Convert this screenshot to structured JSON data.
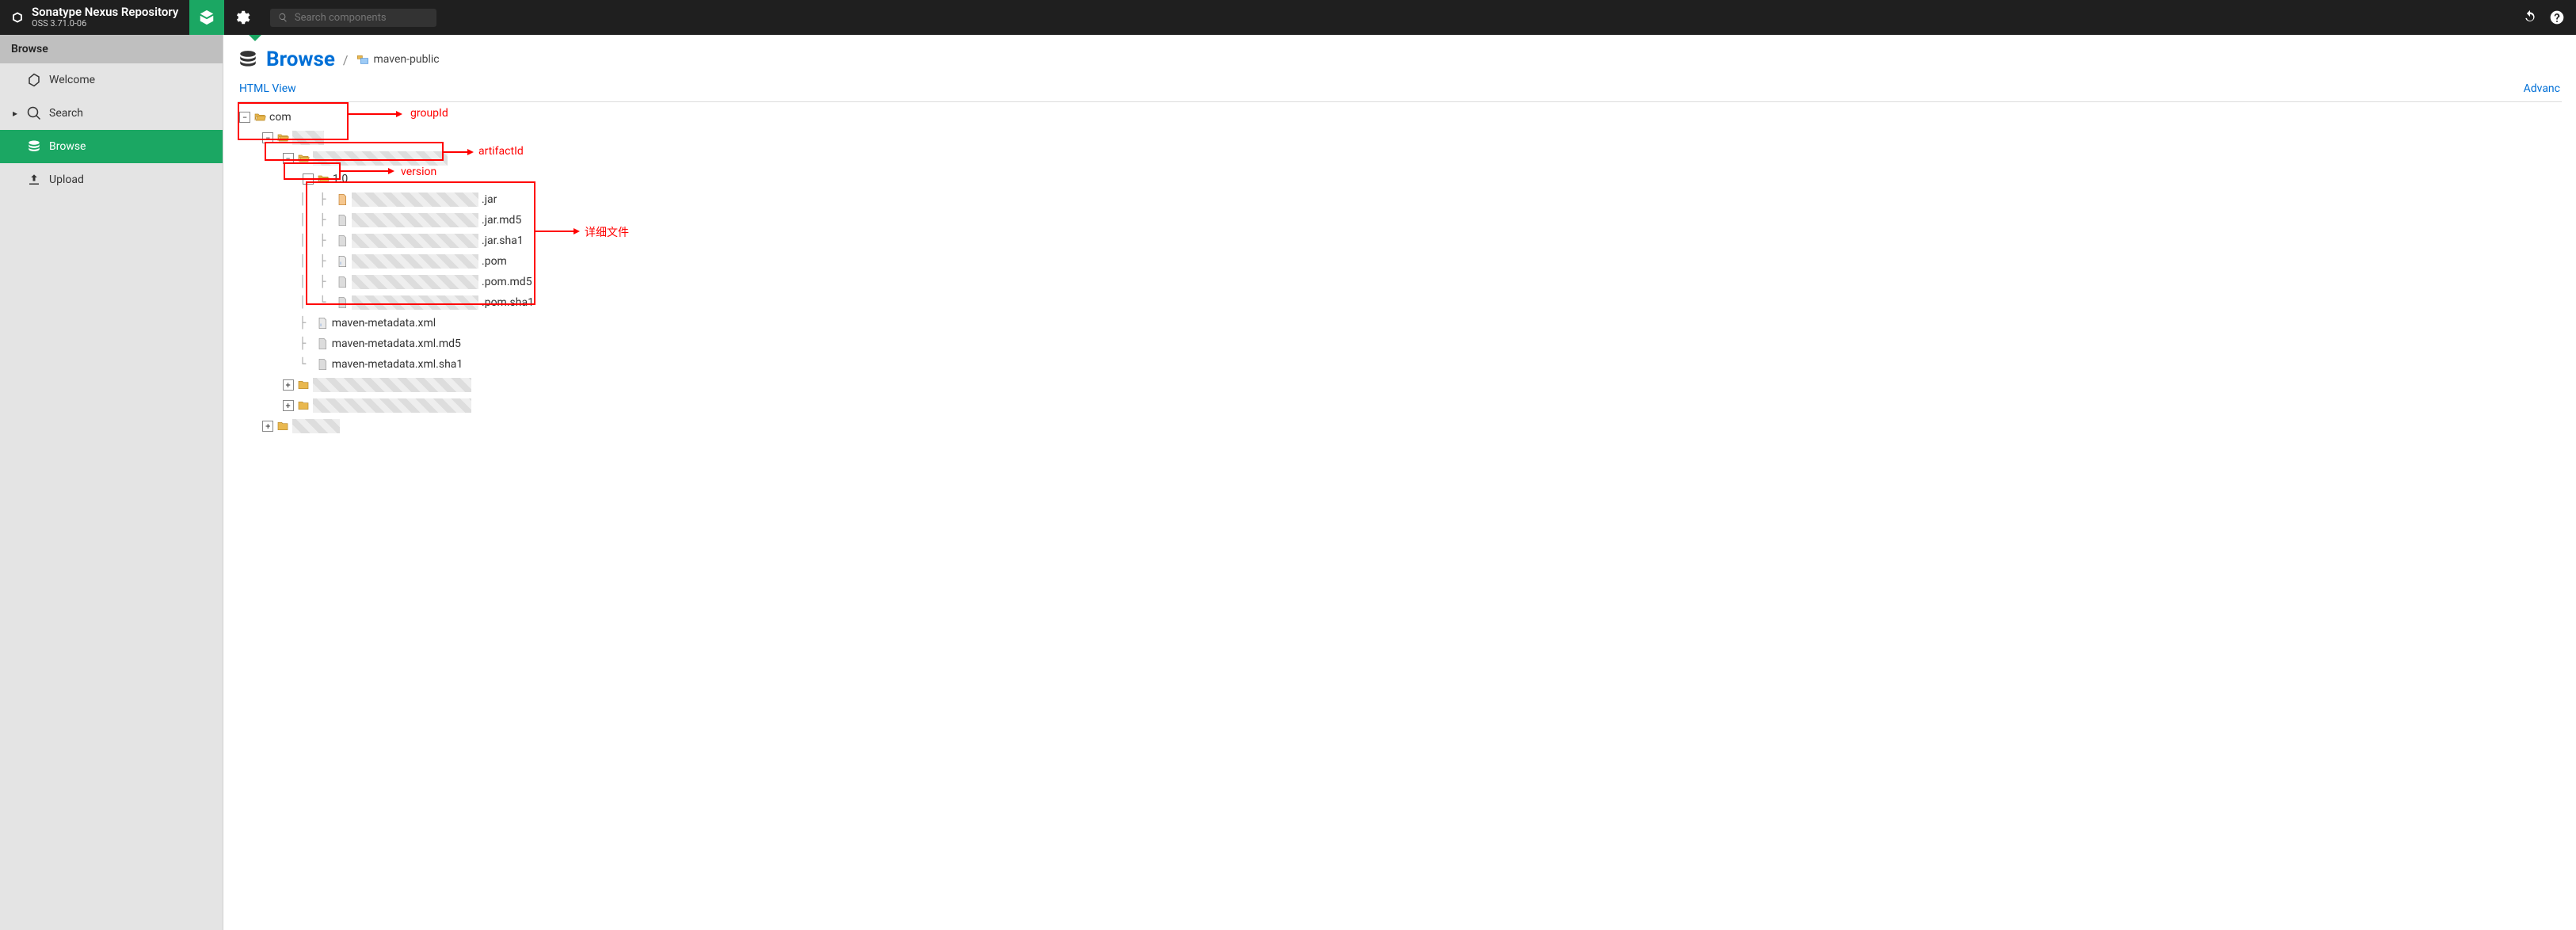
{
  "brand": {
    "title": "Sonatype Nexus Repository",
    "subtitle": "OSS 3.71.0-06"
  },
  "search": {
    "placeholder": "Search components"
  },
  "sidebar": {
    "title": "Browse",
    "items": [
      {
        "label": "Welcome"
      },
      {
        "label": "Search"
      },
      {
        "label": "Browse"
      },
      {
        "label": "Upload"
      }
    ]
  },
  "crumbs": {
    "browse": "Browse",
    "sep": "/",
    "repo": "maven-public"
  },
  "toolbar": {
    "html_view": "HTML View",
    "advanced": "Advanc"
  },
  "tree": {
    "root": "com",
    "version_label": "1.0",
    "files": {
      "jar": ".jar",
      "jar_md5": ".jar.md5",
      "jar_sha1": ".jar.sha1",
      "pom": ".pom",
      "pom_md5": ".pom.md5",
      "pom_sha1": ".pom.sha1"
    },
    "metadata": {
      "xml": "maven-metadata.xml",
      "xml_md5": "maven-metadata.xml.md5",
      "xml_sha1": "maven-metadata.xml.sha1"
    }
  },
  "annotations": {
    "group": "groupId",
    "artifact": "artifactId",
    "version": "version",
    "files": "详细文件"
  }
}
